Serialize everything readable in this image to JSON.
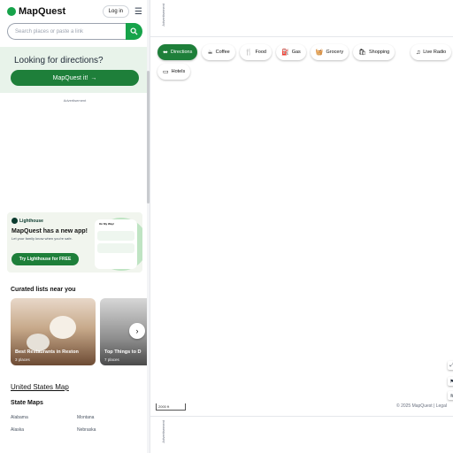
{
  "header": {
    "logo_text": "MapQuest",
    "login_label": "Log in"
  },
  "search": {
    "placeholder": "Search places or paste a link"
  },
  "directions": {
    "title": "Looking for directions?",
    "button_label": "MapQuest it!"
  },
  "sidebar_ad_label": "Advertisement",
  "promo": {
    "brand": "Lighthouse",
    "title": "MapQuest has a new app!",
    "body": "Let your family know when you're safe.",
    "button_label": "Try Lighthouse for FREE",
    "art_heading": "On My Way!"
  },
  "curated": {
    "title": "Curated lists near you",
    "cards": [
      {
        "name": "Best Restaurants in Reston",
        "count": "3 places"
      },
      {
        "name": "Top Things to D",
        "count": "7 places"
      }
    ]
  },
  "us_map_link": "United States Map",
  "state_maps": {
    "title": "State Maps",
    "states": [
      "Alabama",
      "Montana",
      "Alaska",
      "Nebraska"
    ]
  },
  "map": {
    "ad_label": "Advertisement",
    "categories": [
      {
        "label": "Directions",
        "icon": "directions-icon",
        "glyph": "⬌"
      },
      {
        "label": "Coffee",
        "icon": "coffee-icon",
        "glyph": "☕"
      },
      {
        "label": "Food",
        "icon": "food-icon",
        "glyph": "🍴"
      },
      {
        "label": "Gas",
        "icon": "gas-icon",
        "glyph": "⛽"
      },
      {
        "label": "Grocery",
        "icon": "grocery-icon",
        "glyph": "🧺"
      },
      {
        "label": "Shopping",
        "icon": "shopping-icon",
        "glyph": "🛍"
      }
    ],
    "hotels_label": "Hotels",
    "live_radio_label": "Live Radio",
    "scale_label": "2000 ft",
    "copyright": "© 2025 MapQuest | Legal"
  },
  "colors": {
    "brand_green": "#1e7f3a",
    "directions_bg": "#e8f3ea"
  }
}
